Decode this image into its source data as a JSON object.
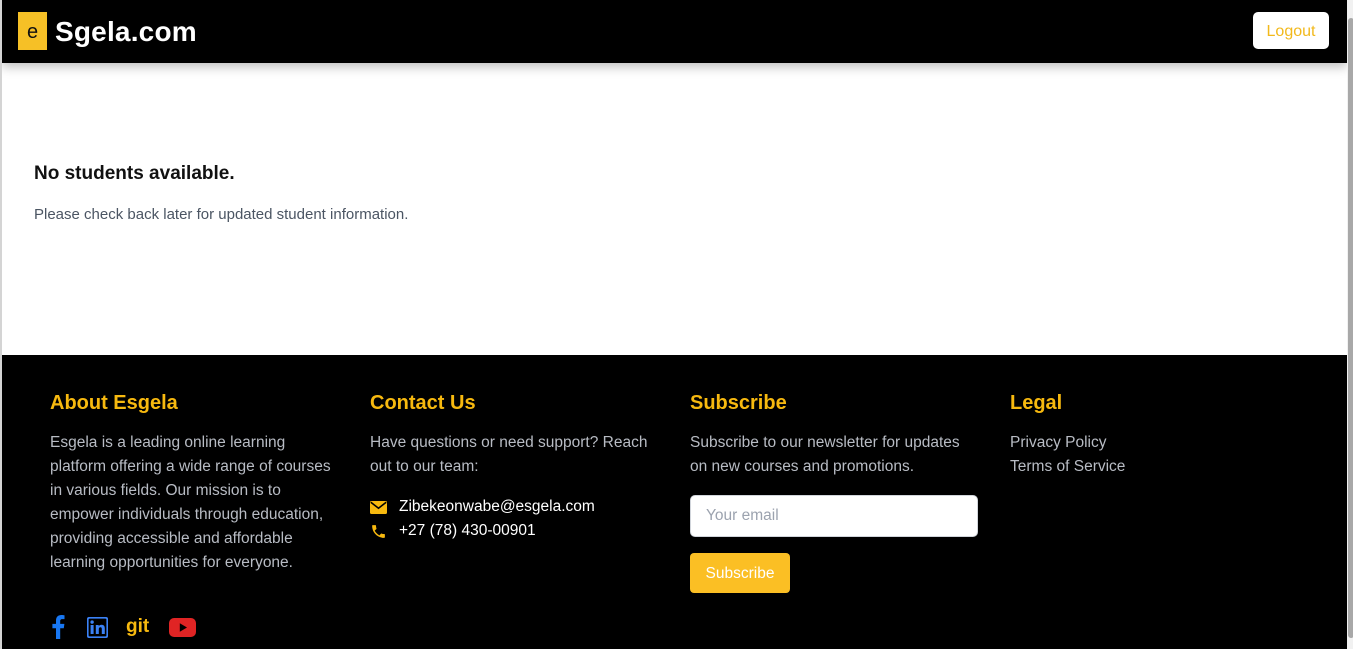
{
  "header": {
    "logo_letter": "e",
    "brand": "Sgela.com",
    "logout_label": "Logout"
  },
  "main": {
    "empty_title": "No students available.",
    "empty_message": "Please check back later for updated student information."
  },
  "footer": {
    "about": {
      "heading": "About Esgela",
      "text": "Esgela is a leading online learning platform offering a wide range of courses in various fields. Our mission is to empower individuals through education, providing accessible and affordable learning opportunities for everyone.",
      "social": [
        {
          "name": "facebook-icon",
          "color": "#1877f2"
        },
        {
          "name": "linkedin-icon",
          "color": "#0a66c2"
        },
        {
          "name": "git-link",
          "label": "git",
          "color": "#f7b90f"
        },
        {
          "name": "youtube-icon",
          "color": "#e02424"
        }
      ]
    },
    "contact": {
      "heading": "Contact Us",
      "text": "Have questions or need support? Reach out to our team:",
      "email": "Zibekeonwabe@esgela.com",
      "phone": "+27 (78) 430-00901"
    },
    "subscribe": {
      "heading": "Subscribe",
      "text": "Subscribe to our newsletter for updates on new courses and promotions.",
      "email_placeholder": "Your email",
      "button_label": "Subscribe"
    },
    "legal": {
      "heading": "Legal",
      "links": [
        "Privacy Policy",
        "Terms of Service"
      ]
    }
  },
  "colors": {
    "accent": "#f7b90f",
    "header_bg": "#000000",
    "footer_bg": "#000000",
    "logout_text": "#f2b91c",
    "subscribe_button": "#fbbf24"
  }
}
